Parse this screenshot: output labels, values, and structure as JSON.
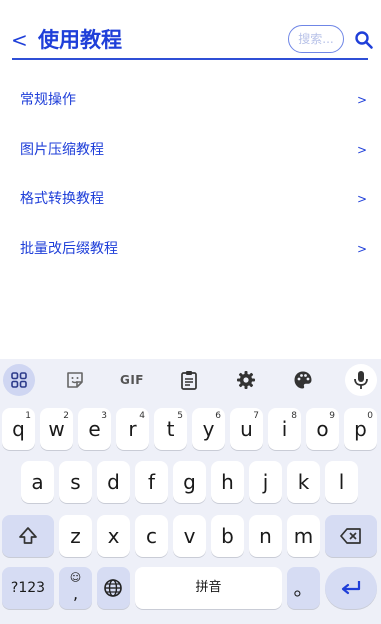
{
  "header": {
    "back_label": "<",
    "title": "使用教程",
    "search_placeholder": "搜索...",
    "accent_color": "#1f3fd9"
  },
  "list": {
    "items": [
      {
        "label": "常规操作",
        "arrow": ">"
      },
      {
        "label": "图片压缩教程",
        "arrow": ">"
      },
      {
        "label": "格式转换教程",
        "arrow": ">"
      },
      {
        "label": "批量改后缀教程",
        "arrow": ">"
      }
    ]
  },
  "keyboard": {
    "toolbar": {
      "icons": [
        "apps-grid-icon",
        "sticker-icon",
        "gif-icon",
        "clipboard-icon",
        "settings-icon",
        "palette-icon",
        "mic-icon"
      ],
      "gif_label": "GIF"
    },
    "row1": [
      {
        "k": "q",
        "n": "1"
      },
      {
        "k": "w",
        "n": "2"
      },
      {
        "k": "e",
        "n": "3"
      },
      {
        "k": "r",
        "n": "4"
      },
      {
        "k": "t",
        "n": "5"
      },
      {
        "k": "y",
        "n": "6"
      },
      {
        "k": "u",
        "n": "7"
      },
      {
        "k": "i",
        "n": "8"
      },
      {
        "k": "o",
        "n": "9"
      },
      {
        "k": "p",
        "n": "0"
      }
    ],
    "row2": [
      "a",
      "s",
      "d",
      "f",
      "g",
      "h",
      "j",
      "k",
      "l"
    ],
    "row3": [
      "z",
      "x",
      "c",
      "v",
      "b",
      "n",
      "m"
    ],
    "bottom": {
      "symbols_label": "?123",
      "emoji_comma_top": "☺",
      "emoji_comma_bottom": ",",
      "space_label": "拼音",
      "period_label": "。"
    }
  }
}
